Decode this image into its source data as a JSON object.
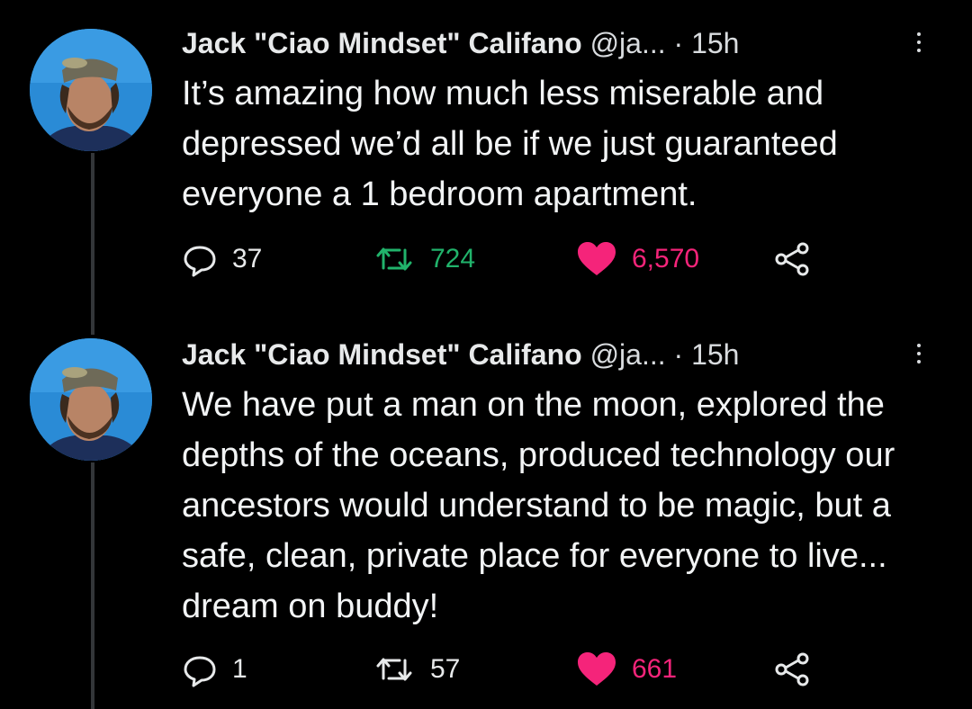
{
  "tweets": [
    {
      "name": "Jack \"Ciao Mindset\" Califano",
      "handle": "@ja...",
      "separator": "·",
      "time": "15h",
      "text": "It’s amazing how much less miserable and depressed we’d all be if we just guaranteed everyone a 1 bedroom apartment.",
      "replies": "37",
      "retweets": "724",
      "likes": "6,570"
    },
    {
      "name": "Jack \"Ciao Mindset\" Califano",
      "handle": "@ja...",
      "separator": "·",
      "time": "15h",
      "text": "We have put a man on the moon, explored the depths of the oceans, produced technology our ancestors would understand to be magic, but a safe, clean, private place for everyone to live... dream on buddy!",
      "replies": "1",
      "retweets": "57",
      "likes": "661"
    }
  ],
  "icons": {
    "reply": "reply-icon",
    "retweet": "retweet-icon",
    "like": "heart-icon",
    "share": "share-icon",
    "more": "more-vertical-icon"
  },
  "colors": {
    "background": "#000000",
    "text": "#e7e9ea",
    "retweet_accent": "#21b36b",
    "like_accent": "#f5247a",
    "thread_line": "#333639"
  }
}
